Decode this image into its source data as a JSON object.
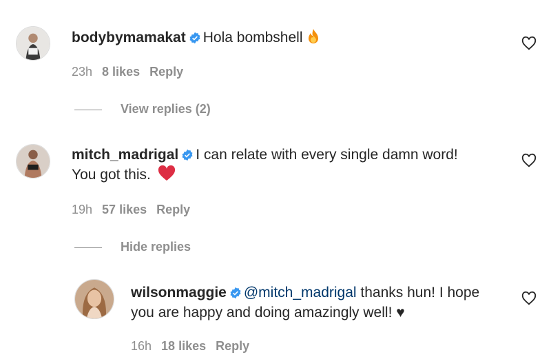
{
  "comments": [
    {
      "username": "bodybymamakat",
      "text": "Hola bombshell",
      "emoji": "fire-emoji",
      "time": "23h",
      "likes": "8 likes",
      "reply": "Reply",
      "replies_toggle": "View replies (2)"
    },
    {
      "username": "mitch_madrigal",
      "text_line1": "I can relate with every single damn word!",
      "text_line2": "You got this.",
      "emoji": "red-heart-emoji",
      "time": "19h",
      "likes": "57 likes",
      "reply": "Reply",
      "replies_toggle": "Hide replies"
    },
    {
      "username": "wilsonmaggie",
      "mention": "@mitch_madrigal",
      "text_line1": " thanks hun! I hope",
      "text_line2": "you are happy and doing amazingly well! ♥",
      "time": "16h",
      "likes": "18 likes",
      "reply": "Reply"
    }
  ],
  "colors": {
    "text": "#262626",
    "meta": "#8e8e8e",
    "verified": "#3897f0",
    "mention": "#00376b"
  }
}
